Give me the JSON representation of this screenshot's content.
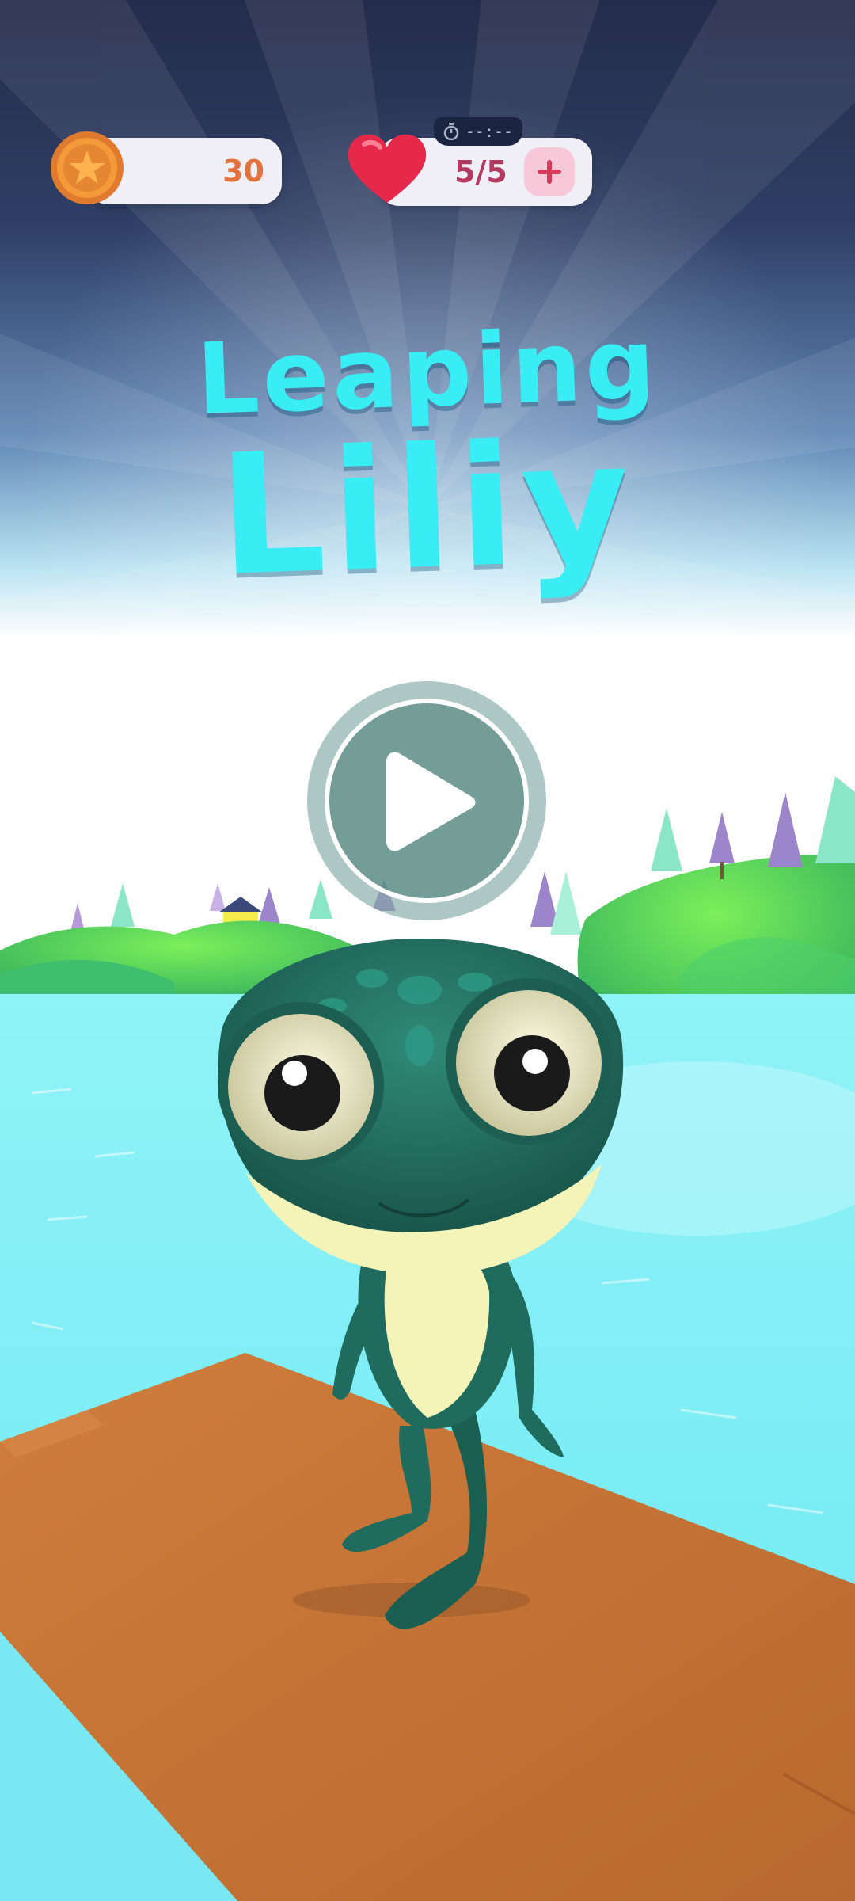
{
  "hud": {
    "coins": "30",
    "lives": "5/5",
    "timer": "--:--"
  },
  "title": {
    "line1": "Leaping",
    "line2": "Liliy"
  },
  "colors": {
    "sky_top": "#26304f",
    "water": "#7ef2f7",
    "dock": "#c27338",
    "title": "#38eef4"
  },
  "icons": {
    "coin": "star-coin-icon",
    "lives": "heart-icon",
    "add": "plus-icon",
    "timer": "stopwatch-icon",
    "play": "play-icon"
  }
}
